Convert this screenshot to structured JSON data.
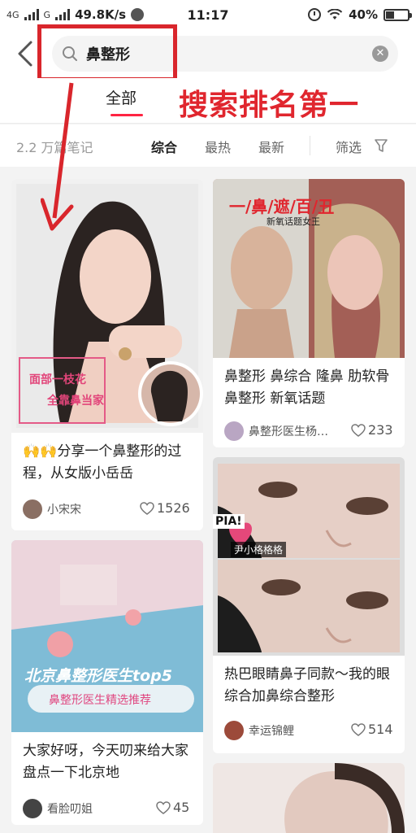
{
  "status_bar": {
    "network1": "4G",
    "network2": "G",
    "speed": "49.8K/s",
    "time": "11:17",
    "battery": "40%",
    "battery_level": 0.4
  },
  "search": {
    "query": "鼻整形"
  },
  "tabs": {
    "all_label": "全部"
  },
  "annotation": "搜索排名第一",
  "filter": {
    "count": "2.2 万篇笔记",
    "sort_options": [
      "综合",
      "最热",
      "最新"
    ],
    "filter_label": "筛选"
  },
  "colors": {
    "accent": "#ff2442",
    "annotation_red": "#e0262e"
  },
  "cards": [
    {
      "image_text1": "面部一枝花",
      "image_text2": "全靠鼻当家",
      "title": "🙌🙌分享一个鼻整形的过程，从女版小岳岳",
      "author": "小宋宋",
      "likes": "1526"
    },
    {
      "image_banner": "一/鼻/遮/百/丑",
      "image_sub": "新氧话题女王",
      "title": "鼻整形 鼻综合 隆鼻 肋软骨鼻整形 新氧话题",
      "author": "鼻整形医生杨…",
      "likes": "233"
    },
    {
      "image_text1": "北京鼻整形医生top5",
      "image_text2": "鼻整形医生精选推荐",
      "title": "大家好呀，今天叨来给大家盘点一下北京地",
      "author": "看脸叨姐",
      "likes": "45"
    },
    {
      "image_sticker": "PIA!",
      "image_label": "尹小格格格",
      "title": "热巴眼睛鼻子同款～我的眼综合加鼻综合整形",
      "author": "幸运锦鲤",
      "likes": "514"
    }
  ]
}
